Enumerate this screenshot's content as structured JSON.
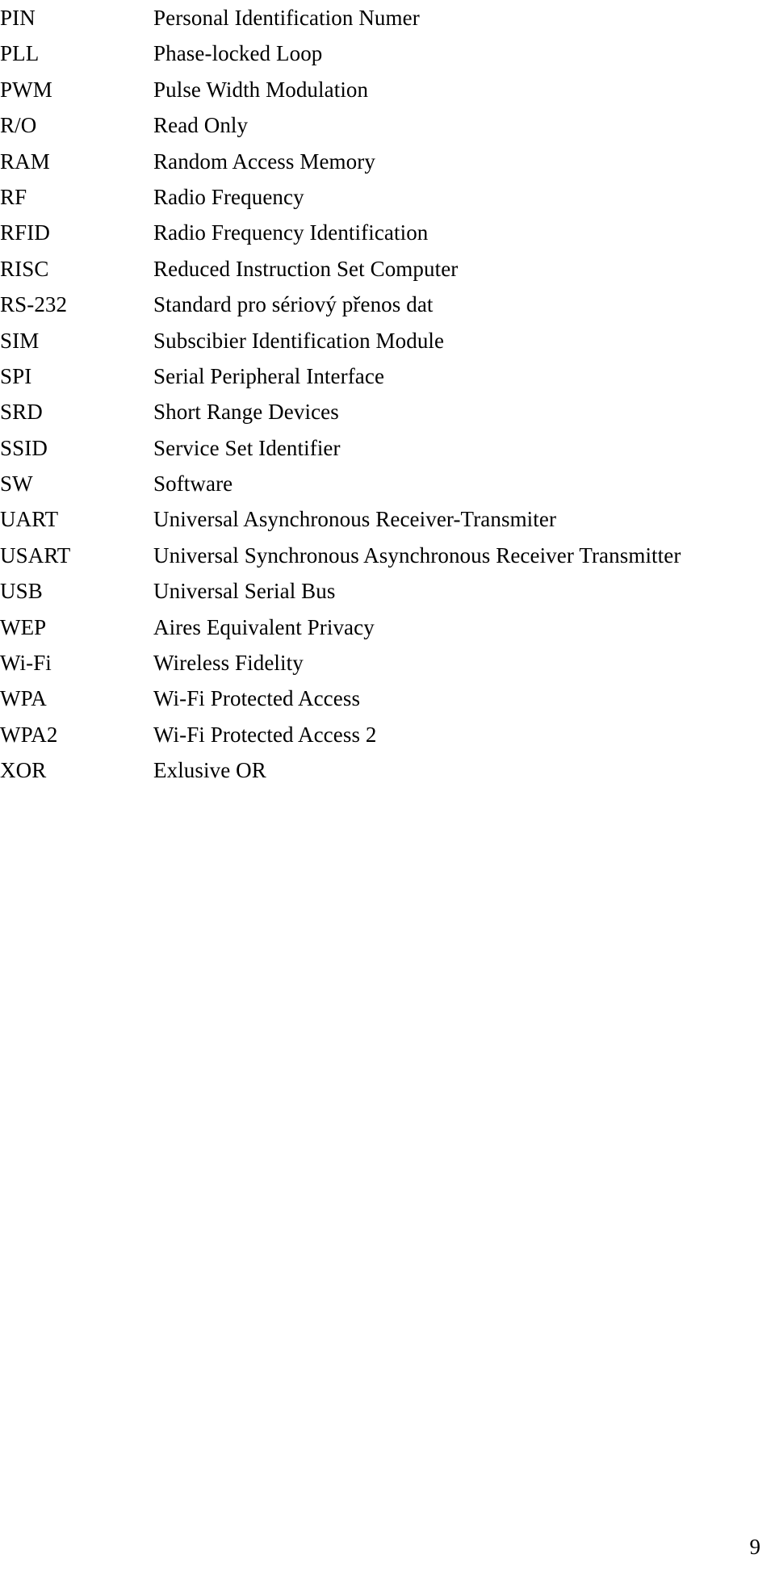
{
  "document": {
    "type": "abbreviations-glossary",
    "page_number": "9",
    "rows": [
      {
        "abbr": "PIN",
        "definition": "Personal Identification Numer"
      },
      {
        "abbr": "PLL",
        "definition": "Phase-locked Loop"
      },
      {
        "abbr": "PWM",
        "definition": "Pulse Width Modulation"
      },
      {
        "abbr": "R/O",
        "definition": "Read Only"
      },
      {
        "abbr": "RAM",
        "definition": "Random Access Memory"
      },
      {
        "abbr": "RF",
        "definition": "Radio Frequency"
      },
      {
        "abbr": "RFID",
        "definition": "Radio Frequency Identification"
      },
      {
        "abbr": "RISC",
        "definition": "Reduced Instruction Set Computer"
      },
      {
        "abbr": "RS-232",
        "definition": "Standard pro sériový přenos dat"
      },
      {
        "abbr": "SIM",
        "definition": "Subscibier Identification Module"
      },
      {
        "abbr": "SPI",
        "definition": "Serial Peripheral Interface"
      },
      {
        "abbr": "SRD",
        "definition": "Short Range Devices"
      },
      {
        "abbr": "SSID",
        "definition": "Service Set Identifier"
      },
      {
        "abbr": "SW",
        "definition": "Software"
      },
      {
        "abbr": "UART",
        "definition": "Universal Asynchronous Receiver-Transmiter"
      },
      {
        "abbr": "USART",
        "definition": "Universal Synchronous Asynchronous Receiver Transmitter"
      },
      {
        "abbr": "USB",
        "definition": "Universal Serial Bus"
      },
      {
        "abbr": "WEP",
        "definition": "Aires Equivalent Privacy"
      },
      {
        "abbr": "Wi-Fi",
        "definition": "Wireless Fidelity"
      },
      {
        "abbr": "WPA",
        "definition": "Wi-Fi Protected Access"
      },
      {
        "abbr": "WPA2",
        "definition": "Wi-Fi Protected Access 2"
      },
      {
        "abbr": "XOR",
        "definition": "Exlusive OR"
      }
    ]
  }
}
